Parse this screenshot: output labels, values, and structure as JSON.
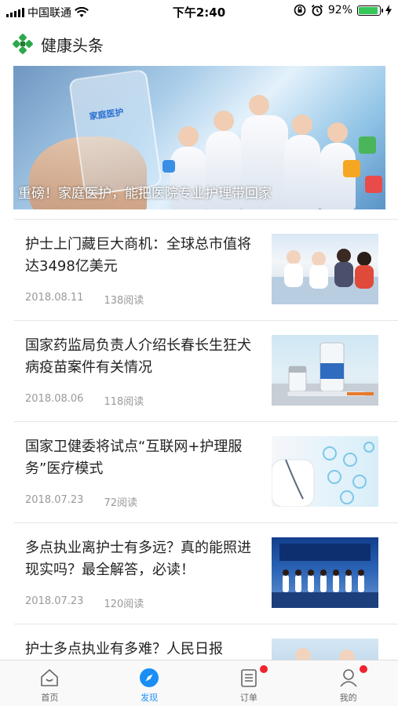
{
  "status_bar": {
    "carrier": "中国联通",
    "time": "下午2:40",
    "battery_percent": "92%",
    "battery_level": 0.92
  },
  "header": {
    "title": "健康头条",
    "logo_icon": "green-cross-logo-icon"
  },
  "banner": {
    "caption": "重磅！家庭医护，能把医院专业护理带回家",
    "logo_text": "家庭医护"
  },
  "articles": [
    {
      "title": "护士上门藏巨大商机：全球总市值将达3498亿美元",
      "date": "2018.08.11",
      "reads": "138阅读"
    },
    {
      "title": "国家药监局负责人介绍长春长生狂犬病疫苗案件有关情况",
      "date": "2018.08.06",
      "reads": "118阅读"
    },
    {
      "title": "国家卫健委将试点“互联网+护理服务”医疗模式",
      "date": "2018.07.23",
      "reads": "72阅读"
    },
    {
      "title": "多点执业离护士有多远？真的能照进现实吗？最全解答，必读！",
      "date": "2018.07.23",
      "reads": "120阅读"
    },
    {
      "title": "护士多点执业有多难？人民日报",
      "date": "",
      "reads": ""
    }
  ],
  "tabbar": {
    "tabs": [
      {
        "label": "首页",
        "icon": "home-icon",
        "active": false,
        "badge": false
      },
      {
        "label": "发现",
        "icon": "compass-icon",
        "active": true,
        "badge": false
      },
      {
        "label": "订单",
        "icon": "order-list-icon",
        "active": false,
        "badge": true
      },
      {
        "label": "我的",
        "icon": "user-icon",
        "active": false,
        "badge": true
      }
    ]
  },
  "colors": {
    "accent": "#1a8ef5",
    "badge": "#f0232e",
    "logo_green": "#2ea84a",
    "battery_green": "#35c759"
  }
}
